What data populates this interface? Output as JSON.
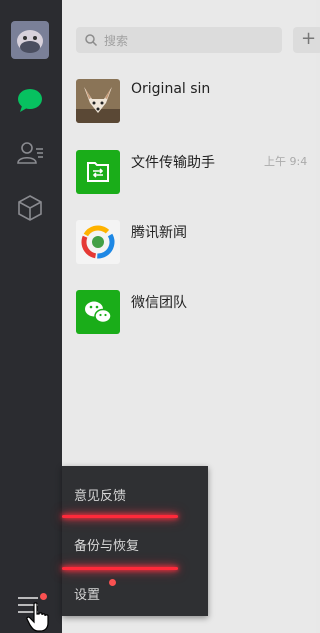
{
  "sidebar": {
    "avatar_icon": "user-avatar",
    "nav": [
      {
        "name": "chat-icon",
        "active": true,
        "color": "#07c160"
      },
      {
        "name": "contacts-icon",
        "active": false
      },
      {
        "name": "favorites-icon",
        "active": false
      }
    ],
    "menu_icon": "hamburger-menu-icon"
  },
  "search": {
    "placeholder": "搜索",
    "add_label": "+"
  },
  "chats": [
    {
      "name": "Original sin",
      "time": "",
      "avatar": "fox-photo"
    },
    {
      "name": "文件传输助手",
      "time": "上午 9:4",
      "avatar": "file-transfer-icon",
      "color": "#1aad19"
    },
    {
      "name": "腾讯新闻",
      "time": "",
      "avatar": "tencent-news-icon"
    },
    {
      "name": "微信团队",
      "time": "",
      "avatar": "wechat-team-icon",
      "color": "#1aad19"
    }
  ],
  "menu": {
    "items": [
      {
        "label": "意见反馈"
      },
      {
        "label": "备份与恢复"
      },
      {
        "label": "设置",
        "badge": true
      }
    ],
    "highlight_color": "#ff2a3a"
  }
}
